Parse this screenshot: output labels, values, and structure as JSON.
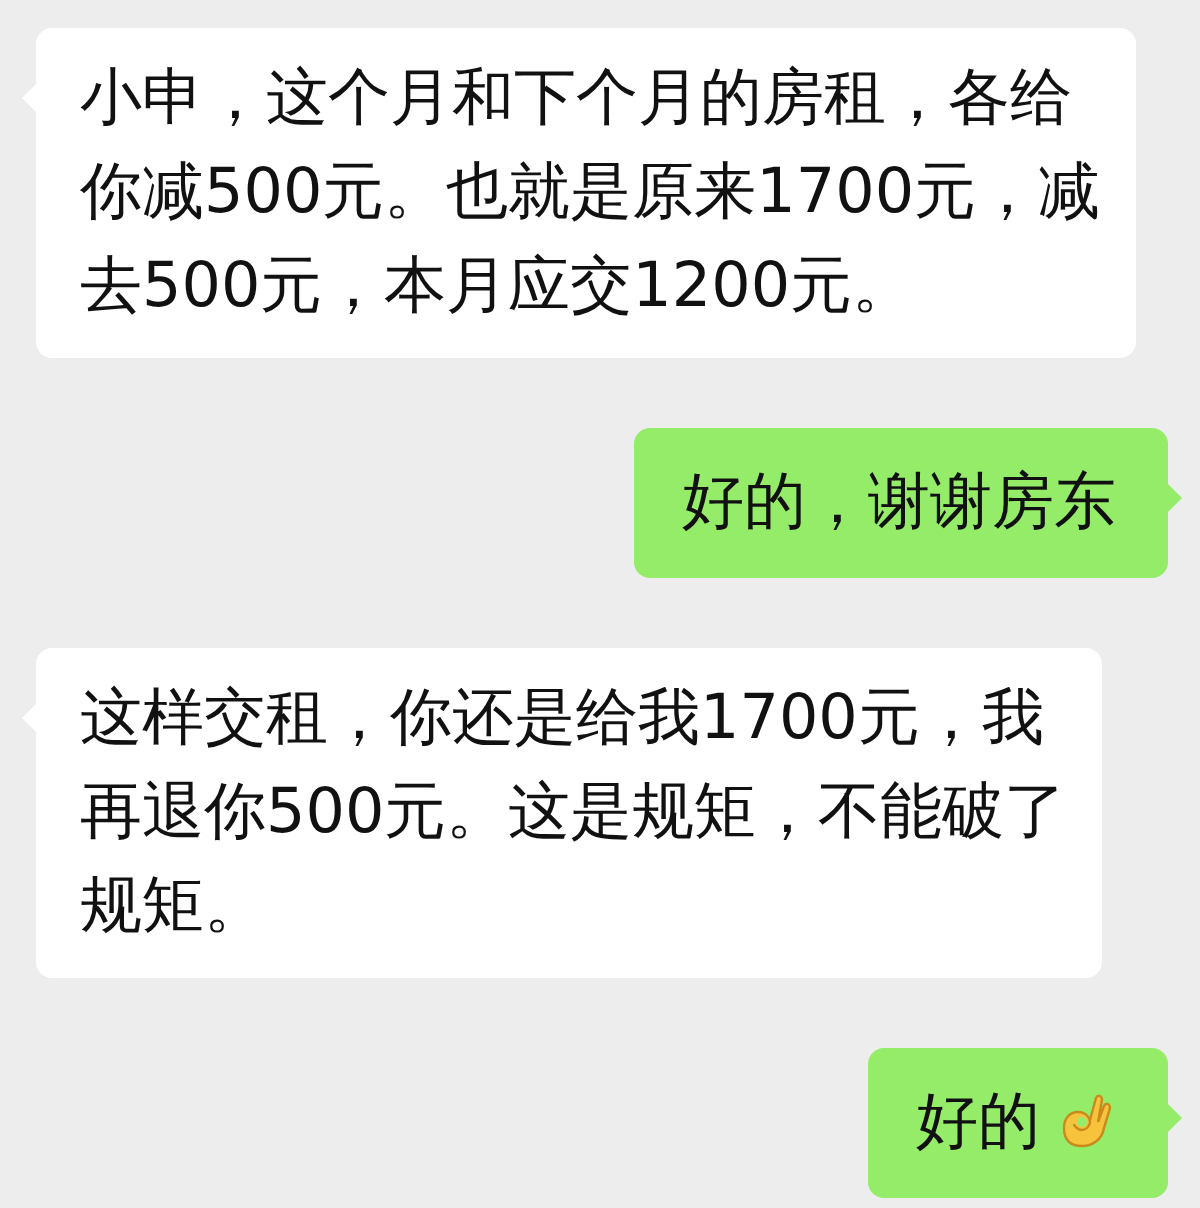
{
  "messages": [
    {
      "kind": "incoming",
      "lines": [
        "小申，这个月和下个月的房租，各给",
        "你减500元。也就是原来1700元，减",
        "去500元，本月应交1200元。"
      ]
    },
    {
      "kind": "outgoing",
      "lines": [
        "好的，谢谢房东"
      ]
    },
    {
      "kind": "incoming",
      "lines": [
        "这样交租，你还是给我1700元，我",
        "再退你500元。这是规矩，不能破了",
        "规矩。"
      ]
    },
    {
      "kind": "outgoing",
      "lines": [
        "好的"
      ],
      "emoji_after": true
    }
  ]
}
